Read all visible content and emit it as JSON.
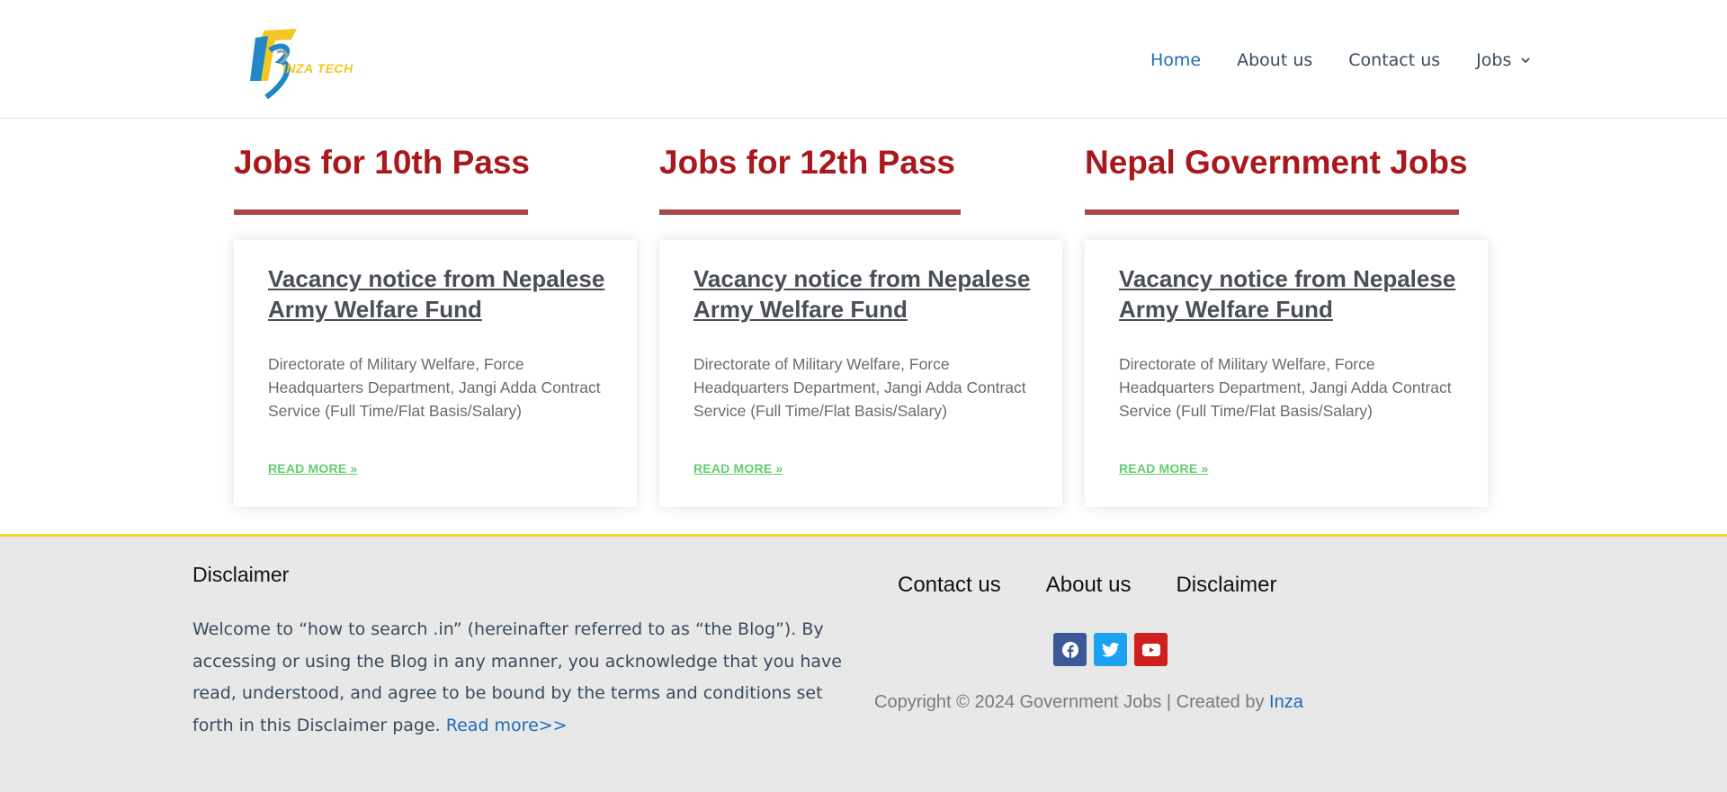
{
  "header": {
    "logo_text": "INZA TECH",
    "nav": [
      {
        "label": "Home",
        "active": true
      },
      {
        "label": "About us"
      },
      {
        "label": "Contact us"
      },
      {
        "label": "Jobs",
        "has_dropdown": true
      }
    ]
  },
  "columns": [
    {
      "title": "Jobs for 10th Pass",
      "card": {
        "title": "Vacancy notice from Nepalese Army Welfare Fund",
        "excerpt": "Directorate of Military Welfare, Force Headquarters Department, Jangi Adda Contract Service (Full Time/Flat Basis/Salary)",
        "read_more": "READ MORE »"
      }
    },
    {
      "title": "Jobs for 12th Pass",
      "card": {
        "title": "Vacancy notice from Nepalese Army Welfare Fund",
        "excerpt": "Directorate of Military Welfare, Force Headquarters Department, Jangi Adda Contract Service (Full Time/Flat Basis/Salary)",
        "read_more": "READ MORE »"
      }
    },
    {
      "title": "Nepal Government Jobs",
      "card": {
        "title": "Vacancy notice from Nepalese Army Welfare Fund",
        "excerpt": "Directorate of Military Welfare, Force Headquarters Department, Jangi Adda Contract Service (Full Time/Flat Basis/Salary)",
        "read_more": "READ MORE »"
      }
    }
  ],
  "footer": {
    "disclaimer_title": "Disclaimer",
    "disclaimer_text": "Welcome to “how to search .in” (hereinafter referred to as “the Blog”). By accessing or using the Blog in any manner, you acknowledge that you have read, understood, and agree to be bound by the terms and conditions set forth in this Disclaimer page. ",
    "disclaimer_more": "Read more>>",
    "links": [
      "Contact us",
      "About us",
      "Disclaimer"
    ],
    "social": [
      {
        "icon": "facebook-icon",
        "color": "#3b5998"
      },
      {
        "icon": "twitter-icon",
        "color": "#1da1f2"
      },
      {
        "icon": "youtube-icon",
        "color": "#cd201f"
      }
    ],
    "copyright_text": "Copyright © 2024 Government Jobs | Created by ",
    "copyright_link": "Inza"
  },
  "colors": {
    "accent_red": "#a8181c",
    "underline": "#a84748",
    "link_blue": "#1e6bb8",
    "read_more_green": "#61ce70",
    "footer_border": "#f0d937",
    "footer_bg": "#e8e8e8"
  }
}
